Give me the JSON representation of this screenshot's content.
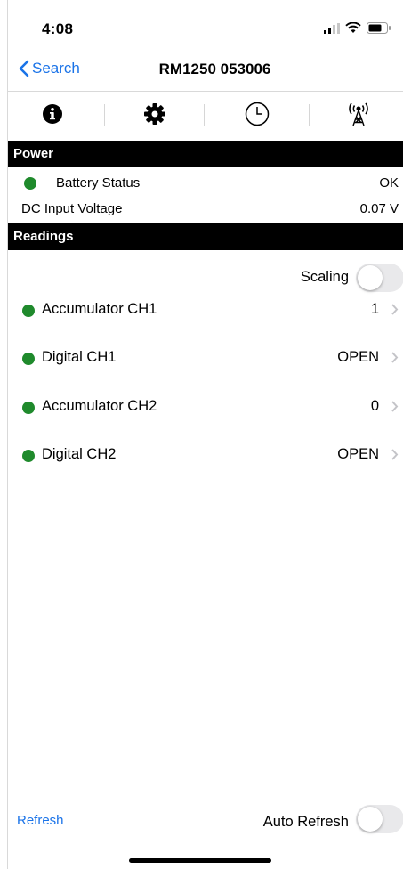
{
  "status_bar": {
    "time": "4:08"
  },
  "nav": {
    "back_label": "Search",
    "title": "RM1250 053006"
  },
  "tabs": [
    {
      "icon": "info-icon"
    },
    {
      "icon": "gear-icon"
    },
    {
      "icon": "clock-icon"
    },
    {
      "icon": "antenna-icon"
    }
  ],
  "power": {
    "header": "Power",
    "battery_label": "Battery Status",
    "battery_value": "OK",
    "dc_label": "DC Input Voltage",
    "dc_value": "0.07 V"
  },
  "readings": {
    "header": "Readings",
    "scaling_label": "Scaling",
    "scaling_on": false,
    "items": [
      {
        "label": "Accumulator CH1",
        "value": "1"
      },
      {
        "label": "Digital CH1",
        "value": "OPEN"
      },
      {
        "label": "Accumulator CH2",
        "value": "0"
      },
      {
        "label": "Digital CH2",
        "value": "OPEN"
      }
    ]
  },
  "footer": {
    "refresh_label": "Refresh",
    "auto_refresh_label": "Auto Refresh",
    "auto_refresh_on": false
  },
  "colors": {
    "accent": "#1a73e8",
    "status_green": "#1f8a2c"
  }
}
